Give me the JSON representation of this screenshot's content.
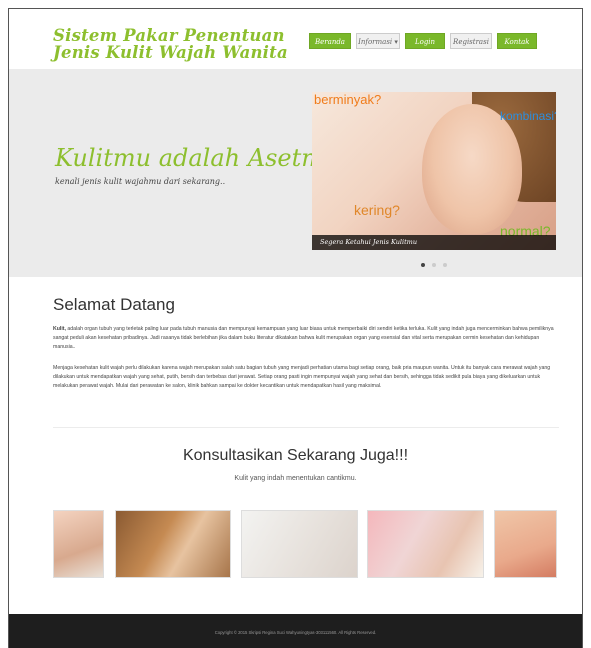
{
  "header": {
    "logo": "Sistem Pakar Penentuan Jenis Kulit Wajah Wanita",
    "nav": [
      {
        "label": "Beranda",
        "active": true
      },
      {
        "label": "Informasi ▾",
        "active": false
      },
      {
        "label": "Login",
        "active": true
      },
      {
        "label": "Registrasi",
        "active": false
      },
      {
        "label": "Kontak",
        "active": true
      }
    ]
  },
  "hero": {
    "title": "Kulitmu adalah Asetmu",
    "subtitle": "kenali jenis kulit wajahmu dari sekarang..",
    "slide": {
      "word1": "berminyak?",
      "word2": "kombinasi?",
      "word3": "kering?",
      "word4": "normal?",
      "caption": "Segera Ketahui Jenis Kulitmu"
    }
  },
  "welcome": {
    "title": "Selamat Datang",
    "p1_bold": "Kulit,",
    "p1_rest": " adalah organ tubuh yang terletak paling luar pada tubuh manusia dan mempunyai kemampuan yang luar biasa untuk memperbaiki diri sendiri ketika terluka. Kulit yang indah juga mencerminkan bahwa pemiliknya sangat peduli akan kesehatan pribadinya. Jadi rasanya tidak berlebihan jika dalam buku literatur dikatakan bahwa kulit merupakan organ yang esensial dan vital serta merupakan cermin kesehatan dan kehidupan manusia..",
    "p2": "Menjaga kesehatan kulit wajah perlu dilakukan karena wajah merupakan salah satu bagian tubuh yang menjadi perhatian utama bagi setiap orang, baik pria maupun wanita. Untuk itu banyak cara merawat wajah yang dilakukan untuk mendapatkan wajah yang sehat, putih, bersih dan terbebas dari jerawat. Setiap orang pasti ingin mempunyai wajah yang sehat dan bersih, sehingga tidak sedikit pula biaya yang dikeluarkan untuk melakukan perawat wajah. Mulai dari perawatan ke salon, klinik bahkan sampai ke dokter kecantikan untuk mendapatkan hasil yang maksimal."
  },
  "consult": {
    "title": "Konsultasikan Sekarang Juga!!!",
    "subtitle": "Kulit yang indah menentukan cantikmu."
  },
  "footer": {
    "copyright": "Copyright © 2015 Skripsi Regina Suci Wahyuningtyas-303111560. All Rights Reserved."
  }
}
